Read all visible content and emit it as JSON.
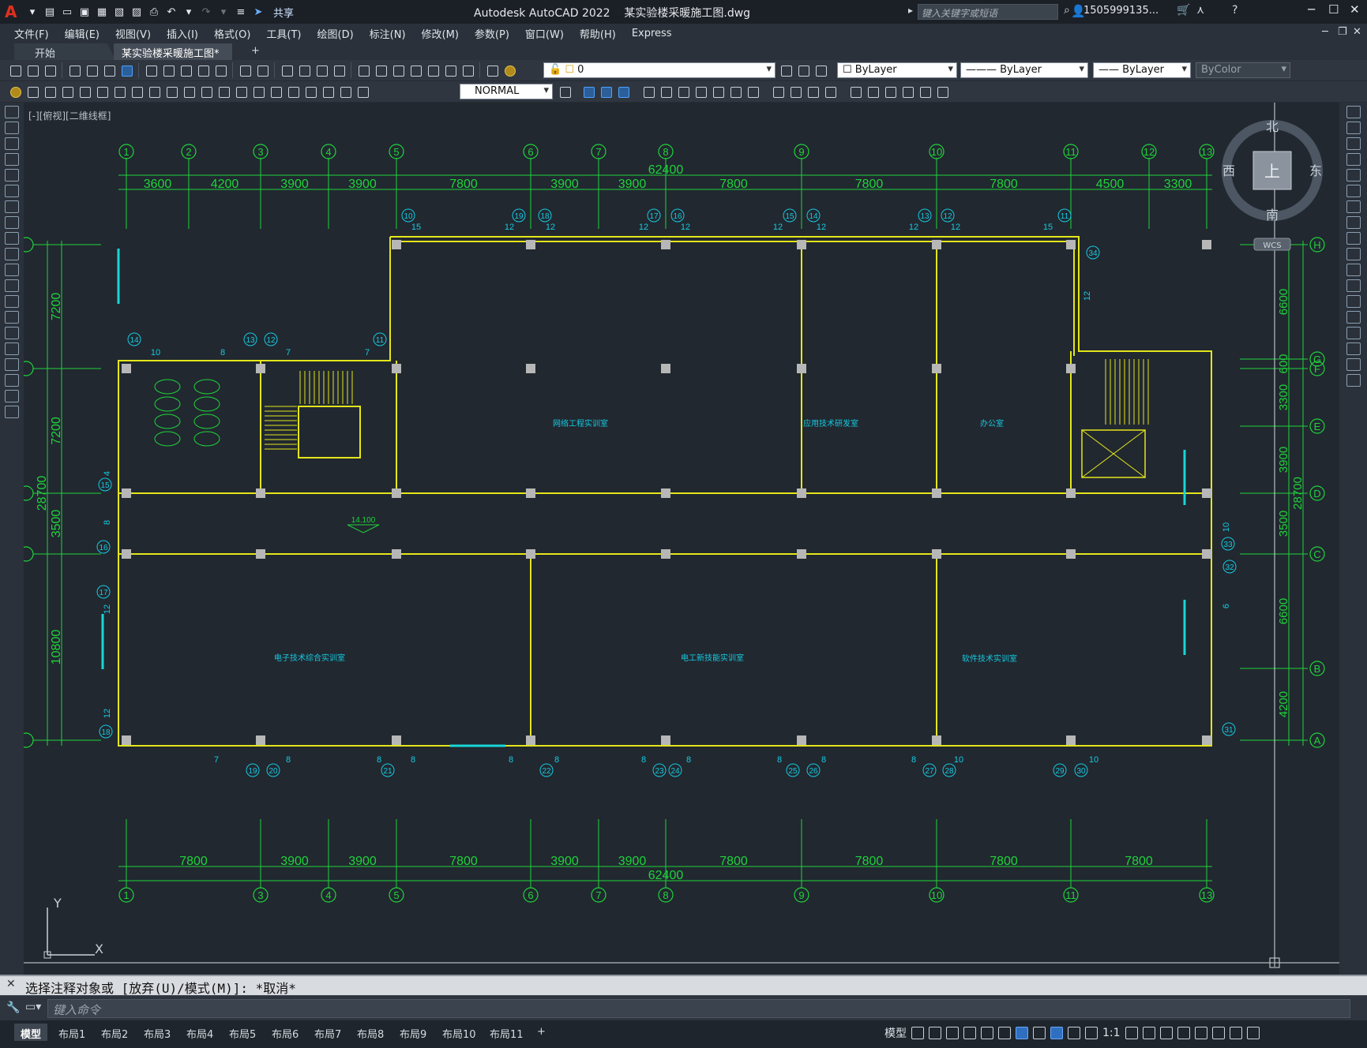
{
  "app": {
    "logo": "A",
    "title": "Autodesk AutoCAD 2022",
    "filename": "某实验楼采暖施工图.dwg",
    "share_label": "共享",
    "search_placeholder": "键入关键字或短语",
    "user": "1505999135...",
    "window_controls": [
      "minimize-icon",
      "maximize-icon",
      "close-icon"
    ]
  },
  "menu": [
    "文件(F)",
    "编辑(E)",
    "视图(V)",
    "插入(I)",
    "格式(O)",
    "工具(T)",
    "绘图(D)",
    "标注(N)",
    "修改(M)",
    "参数(P)",
    "窗口(W)",
    "帮助(H)",
    "Express"
  ],
  "tabs": {
    "start": "开始",
    "drawing": "某实验楼采暖施工图*",
    "add": "+"
  },
  "toolbar": {
    "layer_value": "0",
    "color_value": "ByLayer",
    "linetype_value": "ByLayer",
    "lineweight_value": "ByLayer",
    "plotstyle_value": "ByColor",
    "dimstyle_value": "NORMAL"
  },
  "viewport": {
    "label": "[-][俯视][二维线框]"
  },
  "viewcube": {
    "north": "北",
    "south": "南",
    "west": "西",
    "east": "东",
    "face": "上",
    "wcs": "WCS"
  },
  "drawing": {
    "top_axes": [
      "1",
      "2",
      "3",
      "4",
      "5",
      "6",
      "7",
      "8",
      "9",
      "10",
      "11",
      "12",
      "13"
    ],
    "bottom_axes": [
      "1",
      "3",
      "4",
      "5",
      "6",
      "7",
      "8",
      "9",
      "10",
      "11",
      "13"
    ],
    "row_axes": [
      "H",
      "G",
      "F",
      "E",
      "D",
      "C",
      "B",
      "A"
    ],
    "total_dim": "62400",
    "top_spans": [
      "3600",
      "4200",
      "3900",
      "3900",
      "7800",
      "3900",
      "3900",
      "7800",
      "7800",
      "7800",
      "4500",
      "3300"
    ],
    "bottom_spans": [
      "7800",
      "3900",
      "3900",
      "7800",
      "3900",
      "3900",
      "7800",
      "7800",
      "7800",
      "7800"
    ],
    "left_spans": [
      "7200",
      "7200",
      "3500",
      "10800"
    ],
    "left_total": "28700",
    "right_spans": [
      "6600",
      "600",
      "3300",
      "3900",
      "3500",
      "6600",
      "4200"
    ],
    "right_total": "28700",
    "rooms": [
      "网络工程实训室",
      "应用技术研发室",
      "办公室",
      "电子技术综合实训室",
      "电工新技能实训室",
      "软件技术实训室"
    ],
    "elevation": "14.100",
    "radiator_tags_top": [
      "10",
      "19",
      "18",
      "17",
      "16",
      "15",
      "14",
      "13",
      "12",
      "11"
    ],
    "radiator_tags_bottom": [
      "19",
      "20",
      "21",
      "22",
      "23",
      "24",
      "25",
      "26",
      "27",
      "28",
      "29",
      "30"
    ],
    "radiator_tags_side": [
      "14",
      "13",
      "12",
      "11",
      "15",
      "16",
      "17",
      "18",
      "34",
      "33",
      "32",
      "31"
    ],
    "sections_top": [
      "15",
      "12",
      "12",
      "12",
      "12",
      "12",
      "12",
      "12",
      "12",
      "15"
    ],
    "sections_stair": [
      "10",
      "8",
      "7",
      "7"
    ],
    "sections_bottom": [
      "7",
      "8",
      "8",
      "8",
      "8",
      "8",
      "8",
      "8",
      "8",
      "8",
      "8",
      "10",
      "10"
    ],
    "sections_side": [
      "4",
      "8",
      "12",
      "12",
      "12",
      "10",
      "6"
    ]
  },
  "ucs": {
    "x": "X",
    "y": "Y"
  },
  "command": {
    "history": "选择注释对象或 [放弃(U)/模式(M)]: *取消*",
    "placeholder": "键入命令"
  },
  "layouts": [
    "模型",
    "布局1",
    "布局2",
    "布局3",
    "布局4",
    "布局5",
    "布局6",
    "布局7",
    "布局8",
    "布局9",
    "布局10",
    "布局11",
    "+"
  ],
  "status": {
    "model": "模型",
    "scale": "1:1"
  }
}
